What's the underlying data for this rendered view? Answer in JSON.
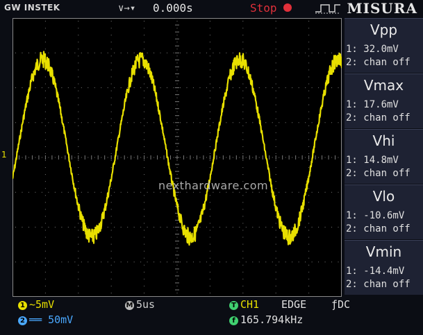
{
  "brand": "GW INSTEK",
  "header": {
    "nav_arrows": "∨→▾",
    "time_offset": "0.000s",
    "run_state": "Stop",
    "title": "MISURA"
  },
  "colors": {
    "ch1": "#e8e000",
    "ch2": "#4aa8ff",
    "stop": "#e0303a",
    "panel": "#1e2233"
  },
  "screen": {
    "channel_marker": "1",
    "watermark": "nexthardware.com"
  },
  "measurements": [
    {
      "name": "Vpp",
      "ch1": "1: 32.0mV",
      "ch2": "2: chan off"
    },
    {
      "name": "Vmax",
      "ch1": "1: 17.6mV",
      "ch2": "2: chan off"
    },
    {
      "name": "Vhi",
      "ch1": "1: 14.8mV",
      "ch2": "2: chan off"
    },
    {
      "name": "Vlo",
      "ch1": "1: -10.6mV",
      "ch2": "2: chan off"
    },
    {
      "name": "Vmin",
      "ch1": "1: -14.4mV",
      "ch2": "2: chan off"
    }
  ],
  "footer": {
    "ch1_badge": "1",
    "ch1_scale": "~5mV",
    "ch2_badge": "2",
    "ch2_scale": "══ 50mV",
    "time_badge": "M",
    "timebase": "5us",
    "trig_badge": "T",
    "trig_source": "CH1",
    "trig_type": "EDGE",
    "trig_coupling": "ƒDC",
    "freq_badge": "f",
    "frequency": "165.794kHz"
  }
}
